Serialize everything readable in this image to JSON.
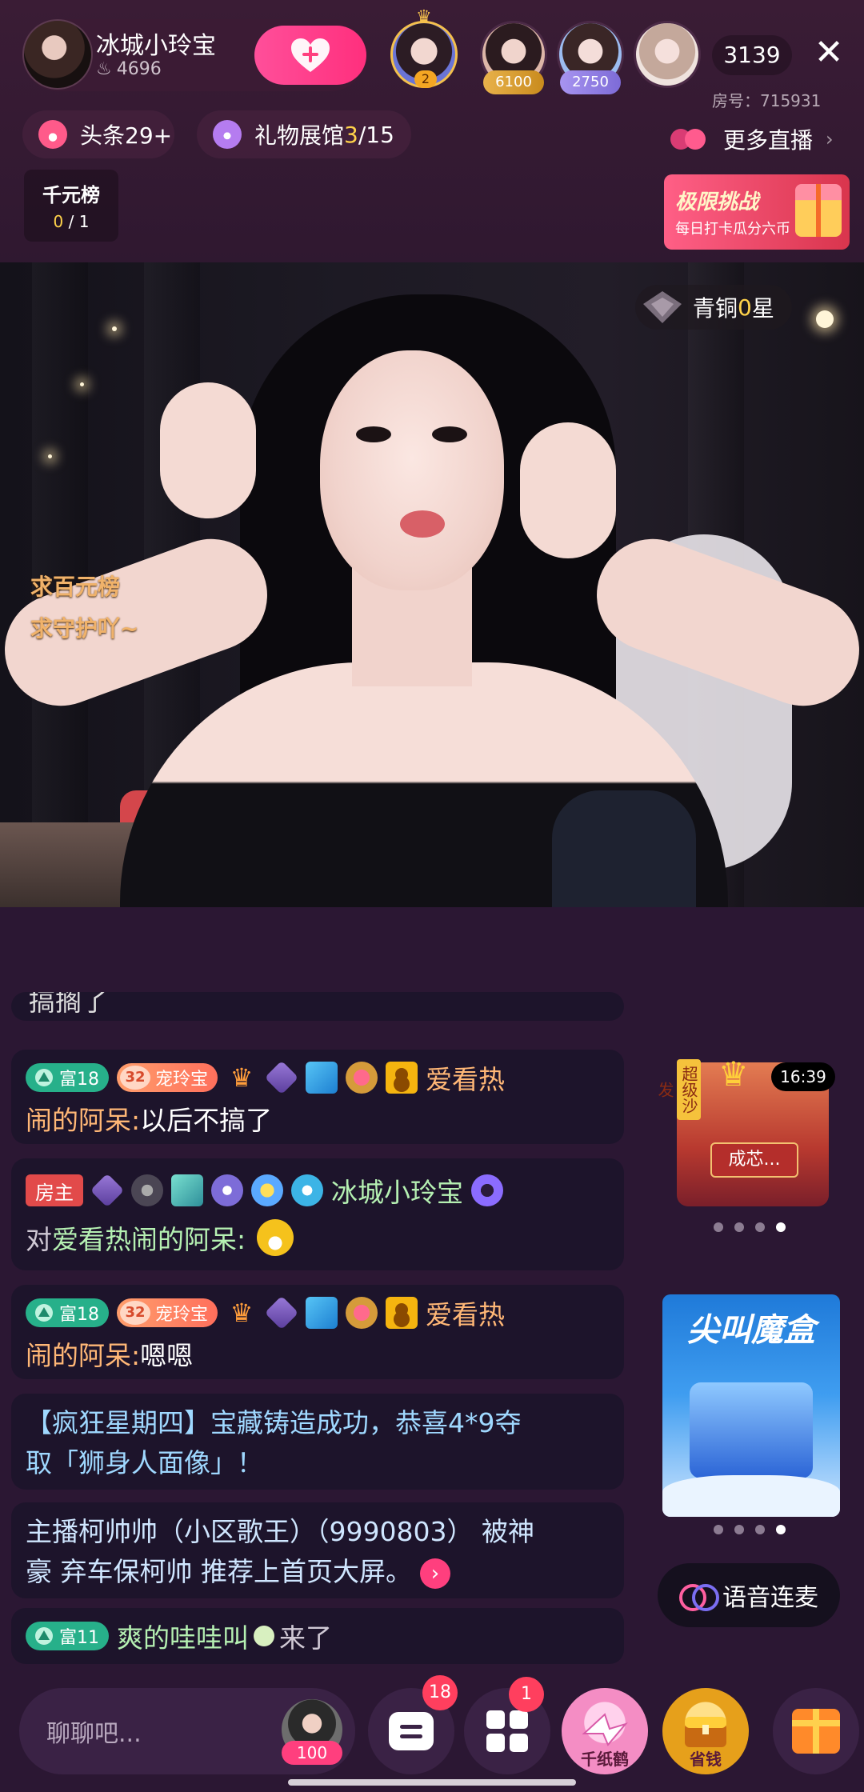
{
  "header": {
    "host_name": "冰城小玲宝",
    "host_fans": "4696",
    "viewer_count": "3139",
    "room_id": "房号：715931",
    "rank_badge": "2",
    "scores": [
      "6100",
      "2750"
    ]
  },
  "tabs": {
    "headline": "头条29+",
    "gift_hall_label": "礼物展馆 ",
    "gift_hall_done": "3",
    "gift_hall_total": "/15",
    "more_live": "更多直播"
  },
  "qianyuan": {
    "title": "千元榜",
    "progress_now": "0",
    "progress_total": " / 1"
  },
  "challenge": {
    "title": "极限挑战",
    "subtitle": "每日打卡瓜分六币"
  },
  "video": {
    "overlay_line1": "求百元榜",
    "overlay_line2": "求守护吖~",
    "rank_label": "青铜",
    "rank_value": "0",
    "rank_suffix": "星"
  },
  "chat": {
    "cut_text": "搞搁了",
    "m1": {
      "rich": "富18",
      "fan_lv": "32",
      "fan_name": "宠玲宝",
      "user_a": "爱看热",
      "user_b": "闹的阿呆:",
      "text": " 以后不搞了"
    },
    "m2": {
      "host_tag": "房主",
      "user": "冰城小玲宝",
      "to": "对 ",
      "target": "爱看热闹的阿呆:"
    },
    "m3": {
      "rich": "富18",
      "fan_lv": "32",
      "fan_name": "宠玲宝",
      "user_a": "爱看热",
      "user_b": "闹的阿呆:",
      "text": " 嗯嗯"
    },
    "m4": {
      "line1": "【疯狂星期四】宝藏铸造成功，恭喜4*9夺",
      "line2": "取「狮身人面像」！"
    },
    "m5": {
      "line1": " 主播柯帅帅（小区歌王）（9990803） 被神",
      "line2": "豪 弃车保柯帅 推荐上首页大屏。"
    },
    "m6": {
      "rich": "富11",
      "user": "爽的哇哇叫",
      "text": " 来了"
    }
  },
  "sofa": {
    "vertical_tag": "超级沙发",
    "timer": "16:39",
    "label": "成芯..."
  },
  "magic_box": {
    "title": "尖叫魔盒"
  },
  "voice": {
    "label": "语音连麦"
  },
  "bottom": {
    "placeholder": "聊聊吧...",
    "avatar_count": "100",
    "chat_badge": "18",
    "apps_badge": "1",
    "crane_label": "千纸鹤",
    "save_label": "省钱"
  },
  "colors": {
    "accent": "#ff3f7e",
    "gold": "#ffd24a",
    "background": "#2b1733"
  }
}
